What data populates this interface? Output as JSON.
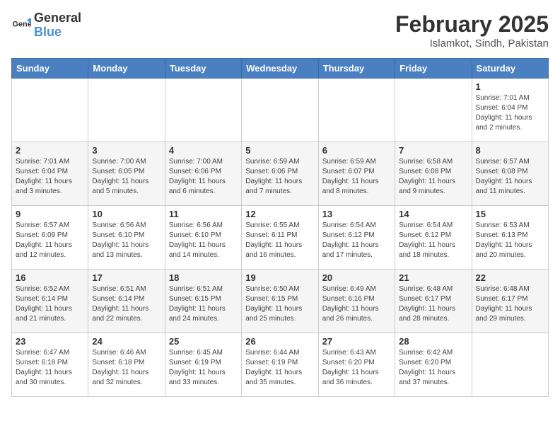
{
  "header": {
    "logo_general": "General",
    "logo_blue": "Blue",
    "title": "February 2025",
    "subtitle": "Islamkot, Sindh, Pakistan"
  },
  "days_of_week": [
    "Sunday",
    "Monday",
    "Tuesday",
    "Wednesday",
    "Thursday",
    "Friday",
    "Saturday"
  ],
  "weeks": [
    [
      {
        "day": "",
        "info": ""
      },
      {
        "day": "",
        "info": ""
      },
      {
        "day": "",
        "info": ""
      },
      {
        "day": "",
        "info": ""
      },
      {
        "day": "",
        "info": ""
      },
      {
        "day": "",
        "info": ""
      },
      {
        "day": "1",
        "info": "Sunrise: 7:01 AM\nSunset: 6:04 PM\nDaylight: 11 hours and 2 minutes."
      }
    ],
    [
      {
        "day": "2",
        "info": "Sunrise: 7:01 AM\nSunset: 6:04 PM\nDaylight: 11 hours and 3 minutes."
      },
      {
        "day": "3",
        "info": "Sunrise: 7:00 AM\nSunset: 6:05 PM\nDaylight: 11 hours and 5 minutes."
      },
      {
        "day": "4",
        "info": "Sunrise: 7:00 AM\nSunset: 6:06 PM\nDaylight: 11 hours and 6 minutes."
      },
      {
        "day": "5",
        "info": "Sunrise: 6:59 AM\nSunset: 6:06 PM\nDaylight: 11 hours and 7 minutes."
      },
      {
        "day": "6",
        "info": "Sunrise: 6:59 AM\nSunset: 6:07 PM\nDaylight: 11 hours and 8 minutes."
      },
      {
        "day": "7",
        "info": "Sunrise: 6:58 AM\nSunset: 6:08 PM\nDaylight: 11 hours and 9 minutes."
      },
      {
        "day": "8",
        "info": "Sunrise: 6:57 AM\nSunset: 6:08 PM\nDaylight: 11 hours and 11 minutes."
      }
    ],
    [
      {
        "day": "9",
        "info": "Sunrise: 6:57 AM\nSunset: 6:09 PM\nDaylight: 11 hours and 12 minutes."
      },
      {
        "day": "10",
        "info": "Sunrise: 6:56 AM\nSunset: 6:10 PM\nDaylight: 11 hours and 13 minutes."
      },
      {
        "day": "11",
        "info": "Sunrise: 6:56 AM\nSunset: 6:10 PM\nDaylight: 11 hours and 14 minutes."
      },
      {
        "day": "12",
        "info": "Sunrise: 6:55 AM\nSunset: 6:11 PM\nDaylight: 11 hours and 16 minutes."
      },
      {
        "day": "13",
        "info": "Sunrise: 6:54 AM\nSunset: 6:12 PM\nDaylight: 11 hours and 17 minutes."
      },
      {
        "day": "14",
        "info": "Sunrise: 6:54 AM\nSunset: 6:12 PM\nDaylight: 11 hours and 18 minutes."
      },
      {
        "day": "15",
        "info": "Sunrise: 6:53 AM\nSunset: 6:13 PM\nDaylight: 11 hours and 20 minutes."
      }
    ],
    [
      {
        "day": "16",
        "info": "Sunrise: 6:52 AM\nSunset: 6:14 PM\nDaylight: 11 hours and 21 minutes."
      },
      {
        "day": "17",
        "info": "Sunrise: 6:51 AM\nSunset: 6:14 PM\nDaylight: 11 hours and 22 minutes."
      },
      {
        "day": "18",
        "info": "Sunrise: 6:51 AM\nSunset: 6:15 PM\nDaylight: 11 hours and 24 minutes."
      },
      {
        "day": "19",
        "info": "Sunrise: 6:50 AM\nSunset: 6:15 PM\nDaylight: 11 hours and 25 minutes."
      },
      {
        "day": "20",
        "info": "Sunrise: 6:49 AM\nSunset: 6:16 PM\nDaylight: 11 hours and 26 minutes."
      },
      {
        "day": "21",
        "info": "Sunrise: 6:48 AM\nSunset: 6:17 PM\nDaylight: 11 hours and 28 minutes."
      },
      {
        "day": "22",
        "info": "Sunrise: 6:48 AM\nSunset: 6:17 PM\nDaylight: 11 hours and 29 minutes."
      }
    ],
    [
      {
        "day": "23",
        "info": "Sunrise: 6:47 AM\nSunset: 6:18 PM\nDaylight: 11 hours and 30 minutes."
      },
      {
        "day": "24",
        "info": "Sunrise: 6:46 AM\nSunset: 6:18 PM\nDaylight: 11 hours and 32 minutes."
      },
      {
        "day": "25",
        "info": "Sunrise: 6:45 AM\nSunset: 6:19 PM\nDaylight: 11 hours and 33 minutes."
      },
      {
        "day": "26",
        "info": "Sunrise: 6:44 AM\nSunset: 6:19 PM\nDaylight: 11 hours and 35 minutes."
      },
      {
        "day": "27",
        "info": "Sunrise: 6:43 AM\nSunset: 6:20 PM\nDaylight: 11 hours and 36 minutes."
      },
      {
        "day": "28",
        "info": "Sunrise: 6:42 AM\nSunset: 6:20 PM\nDaylight: 11 hours and 37 minutes."
      },
      {
        "day": "",
        "info": ""
      }
    ]
  ]
}
